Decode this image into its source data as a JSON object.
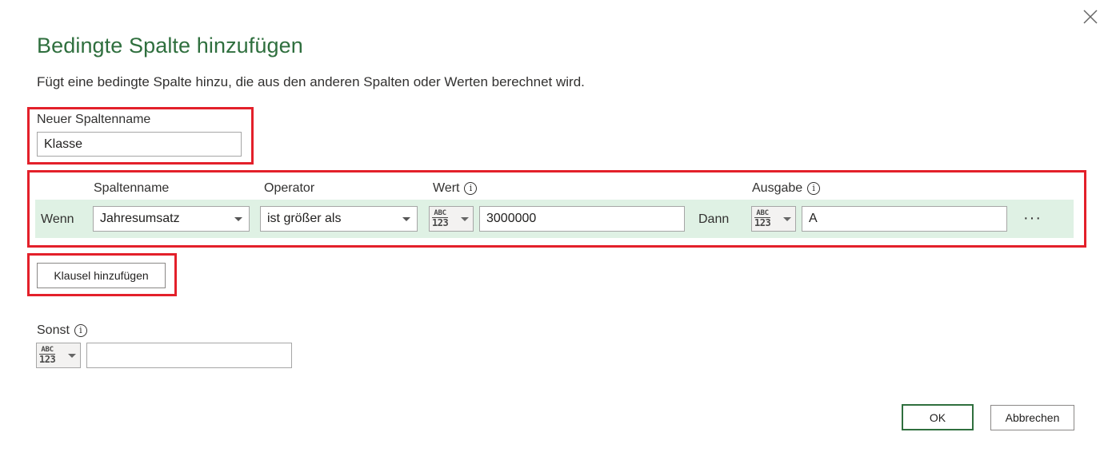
{
  "dialog": {
    "title": "Bedingte Spalte hinzufügen",
    "description": "Fügt eine bedingte Spalte hinzu, die aus den anderen Spalten oder Werten berechnet wird.",
    "close_icon": "close-icon"
  },
  "new_column": {
    "label": "Neuer Spaltenname",
    "value": "Klasse"
  },
  "clause_headers": {
    "column_name": "Spaltenname",
    "operator": "Operator",
    "value": "Wert",
    "output": "Ausgabe"
  },
  "clauses": [
    {
      "if_label": "Wenn",
      "column": "Jahresumsatz",
      "operator": "ist größer als",
      "value_type": {
        "abc": "ABC",
        "num": "123"
      },
      "value": "3000000",
      "then_label": "Dann",
      "output_type": {
        "abc": "ABC",
        "num": "123"
      },
      "output": "A",
      "more_label": "···"
    }
  ],
  "add_clause_label": "Klausel hinzufügen",
  "else": {
    "label": "Sonst",
    "type": {
      "abc": "ABC",
      "num": "123"
    },
    "value": ""
  },
  "buttons": {
    "ok": "OK",
    "cancel": "Abbrechen"
  },
  "colors": {
    "title": "#2f6f3e",
    "highlight": "#e3202a",
    "clause_row_bg": "#dff1e4"
  }
}
